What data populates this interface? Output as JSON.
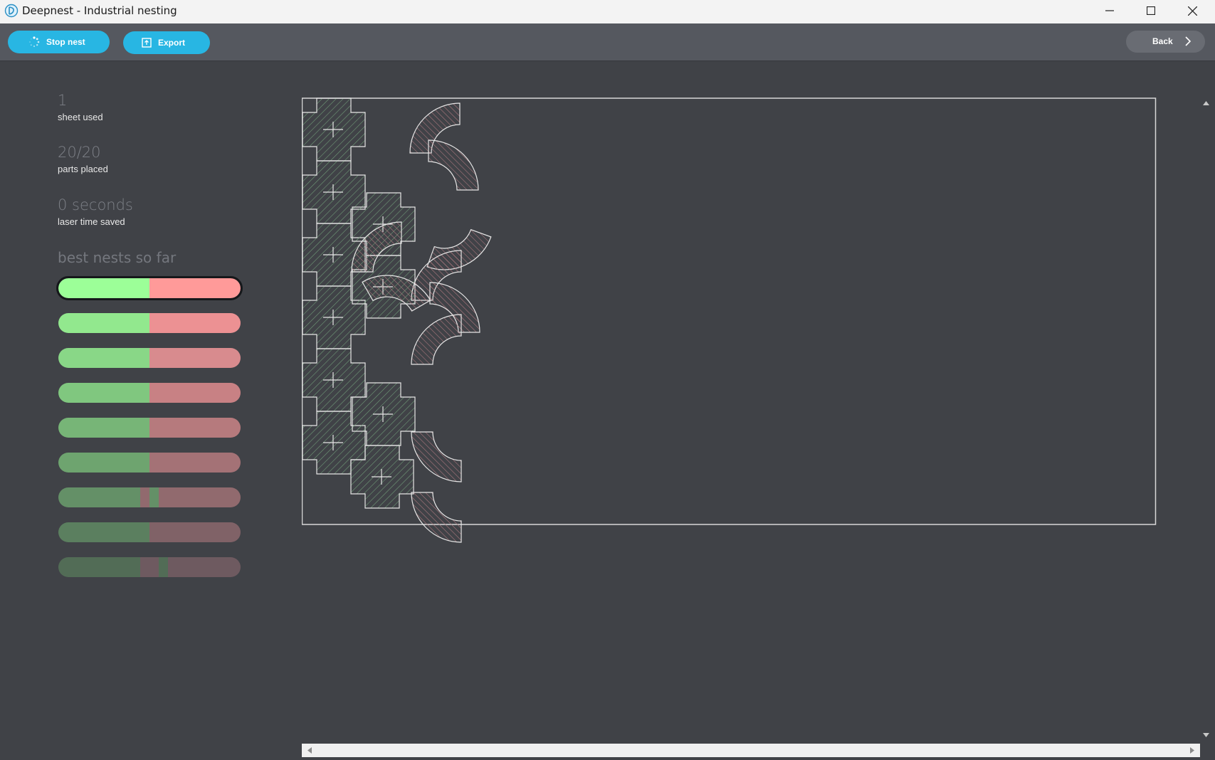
{
  "window": {
    "title": "Deepnest - Industrial nesting"
  },
  "toolbar": {
    "stop_nest_label": "Stop nest",
    "export_label": "Export",
    "back_label": "Back"
  },
  "stats": {
    "sheets_value": "1",
    "sheets_label": "sheet used",
    "parts_value": "20/20",
    "parts_label": "parts placed",
    "time_value": "0 seconds",
    "time_label": "laser time saved"
  },
  "best_nests": {
    "heading": "best nests so far",
    "items": [
      {
        "selected": true,
        "segments": [
          {
            "type": "fit",
            "share": 0.5
          },
          {
            "type": "waste",
            "share": 0.5
          }
        ],
        "color_fit": "#9cff98",
        "color_waste": "#ff9a99"
      },
      {
        "selected": false,
        "segments": [
          {
            "type": "fit",
            "share": 0.5
          },
          {
            "type": "waste",
            "share": 0.5
          }
        ],
        "color_fit": "#92e88e",
        "color_waste": "#ec9193"
      },
      {
        "selected": false,
        "segments": [
          {
            "type": "fit",
            "share": 0.5
          },
          {
            "type": "waste",
            "share": 0.5
          }
        ],
        "color_fit": "#89d787",
        "color_waste": "#d88b8e"
      },
      {
        "selected": false,
        "segments": [
          {
            "type": "fit",
            "share": 0.5
          },
          {
            "type": "waste",
            "share": 0.5
          }
        ],
        "color_fit": "#80c77f",
        "color_waste": "#c88184"
      },
      {
        "selected": false,
        "segments": [
          {
            "type": "fit",
            "share": 0.5
          },
          {
            "type": "waste",
            "share": 0.5
          }
        ],
        "color_fit": "#77b577",
        "color_waste": "#b67a7d"
      },
      {
        "selected": false,
        "segments": [
          {
            "type": "fit",
            "share": 0.5
          },
          {
            "type": "waste",
            "share": 0.5
          }
        ],
        "color_fit": "#6ea46f",
        "color_waste": "#a47276"
      },
      {
        "selected": false,
        "segments": [
          {
            "type": "fit",
            "share": 0.45
          },
          {
            "type": "waste",
            "share": 0.05
          },
          {
            "type": "fit",
            "share": 0.05
          },
          {
            "type": "waste",
            "share": 0.45
          }
        ],
        "color_fit": "#649067",
        "color_waste": "#916a6e"
      },
      {
        "selected": false,
        "segments": [
          {
            "type": "fit",
            "share": 0.5
          },
          {
            "type": "waste",
            "share": 0.5
          }
        ],
        "color_fit": "#5b7f5f",
        "color_waste": "#806267"
      },
      {
        "selected": false,
        "segments": [
          {
            "type": "fit",
            "share": 0.45
          },
          {
            "type": "waste",
            "share": 0.1
          },
          {
            "type": "fit",
            "share": 0.05
          },
          {
            "type": "waste",
            "share": 0.4
          }
        ],
        "color_fit": "#526c56",
        "color_waste": "#6e5a60"
      }
    ]
  },
  "colors": {
    "accent": "#28b6e3",
    "part_stroke": "#e6e6e6",
    "cross_hatch": "#6f9a77",
    "arc_hatch": "#b07a80",
    "sheet_outline": "#d8d8d8"
  },
  "icons": {
    "app": "deepnest-logo-icon",
    "stop": "spinner-icon",
    "export": "export-icon",
    "back": "chevron-right-icon"
  },
  "sheet": {
    "parts": [
      {
        "kind": "cross",
        "col": 0,
        "row": 0
      },
      {
        "kind": "cross",
        "col": 0,
        "row": 1
      },
      {
        "kind": "cross",
        "col": 0,
        "row": 2
      },
      {
        "kind": "cross",
        "col": 0,
        "row": 3
      },
      {
        "kind": "cross",
        "col": 0,
        "row": 4
      },
      {
        "kind": "cross",
        "col": 0,
        "row": 5
      },
      {
        "kind": "cross",
        "col": 1,
        "row": 2
      },
      {
        "kind": "cross",
        "col": 1,
        "row": 3
      },
      {
        "kind": "cross",
        "col": 1,
        "row": 5
      },
      {
        "kind": "cross",
        "col": 1,
        "row": 6
      },
      {
        "kind": "arc",
        "slot": 0
      },
      {
        "kind": "arc",
        "slot": 1
      },
      {
        "kind": "arc",
        "slot": 2
      },
      {
        "kind": "arc",
        "slot": 3
      },
      {
        "kind": "arc",
        "slot": 4
      },
      {
        "kind": "arc",
        "slot": 5
      },
      {
        "kind": "arc",
        "slot": 6
      },
      {
        "kind": "arc",
        "slot": 7
      },
      {
        "kind": "arc",
        "slot": 8
      },
      {
        "kind": "arc",
        "slot": 9
      }
    ]
  }
}
